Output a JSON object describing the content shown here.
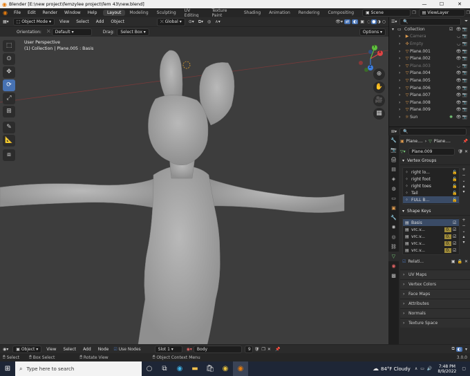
{
  "window": {
    "title": "Blender [E:\\new project\\femzylee project\\fem 43\\new.blend]",
    "minimize": "—",
    "maximize": "☐",
    "close": "✕"
  },
  "menu": [
    "File",
    "Edit",
    "Render",
    "Window",
    "Help"
  ],
  "workspaces": [
    "Layout",
    "Modeling",
    "Sculpting",
    "UV Editing",
    "Texture Paint",
    "Shading",
    "Animation",
    "Rendering",
    "Compositing"
  ],
  "active_workspace": "Layout",
  "scene": "Scene",
  "view_layer": "ViewLayer",
  "viewport_header": {
    "mode": "Object Mode",
    "menus": [
      "View",
      "Select",
      "Add",
      "Object"
    ],
    "transform": "Global",
    "orientation_label": "Orientation:",
    "orientation_value": "Default",
    "drag_label": "Drag:",
    "drag_value": "Select Box",
    "options": "Options"
  },
  "overlay": {
    "view_name": "User Perspective",
    "context": "(1) Collection | Plane.005 : Basis"
  },
  "gizmo": {
    "x": "X",
    "y": "Y",
    "z": "Z"
  },
  "outliner": {
    "search_placeholder": "",
    "collection": "Collection",
    "items": [
      {
        "name": "Camera",
        "hidden": true
      },
      {
        "name": "Empty",
        "hidden": true
      },
      {
        "name": "Plane.001",
        "hidden": false
      },
      {
        "name": "Plane.002",
        "hidden": false
      },
      {
        "name": "Plane.003",
        "hidden": true
      },
      {
        "name": "Plane.004",
        "hidden": false
      },
      {
        "name": "Plane.005",
        "hidden": false
      },
      {
        "name": "Plane.006",
        "hidden": false
      },
      {
        "name": "Plane.007",
        "hidden": false
      },
      {
        "name": "Plane.008",
        "hidden": false
      },
      {
        "name": "Plane.009",
        "hidden": false
      },
      {
        "name": "Sun",
        "hidden": false
      }
    ]
  },
  "properties": {
    "breadcrumb_a": "Plane....",
    "breadcrumb_b": "Plane....",
    "mesh_name": "Plane.009",
    "vertex_groups_title": "Vertex Groups",
    "vertex_groups": [
      "right lo...",
      "right foot",
      "right toes",
      "Tail",
      "FULL B..."
    ],
    "shape_keys_title": "Shape Keys",
    "shape_keys": [
      {
        "name": "Basis"
      },
      {
        "name": "vrc.v...",
        "value": "0."
      },
      {
        "name": "vrc.v...",
        "value": "0."
      },
      {
        "name": "vrc.v...",
        "value": "0."
      },
      {
        "name": "vrc.v...",
        "value": "0."
      }
    ],
    "relative_label": "Relati...",
    "collapsed_panels": [
      "UV Maps",
      "Vertex Colors",
      "Face Maps",
      "Attributes",
      "Normals",
      "Texture Space"
    ]
  },
  "timeline": {
    "mode": "Object",
    "menus": [
      "View",
      "Select",
      "Add",
      "Node"
    ],
    "use_nodes": "Use Nodes",
    "slot": "Slot 1",
    "material": "Body",
    "users": "9"
  },
  "statusbar": {
    "select": "Select",
    "box_select": "Box Select",
    "rotate": "Rotate View",
    "context_menu": "Object Context Menu",
    "version": "3.0.0"
  },
  "taskbar": {
    "search_placeholder": "Type here to search",
    "weather": "84°F  Cloudy",
    "time": "7:48 PM",
    "date": "8/9/2022"
  }
}
